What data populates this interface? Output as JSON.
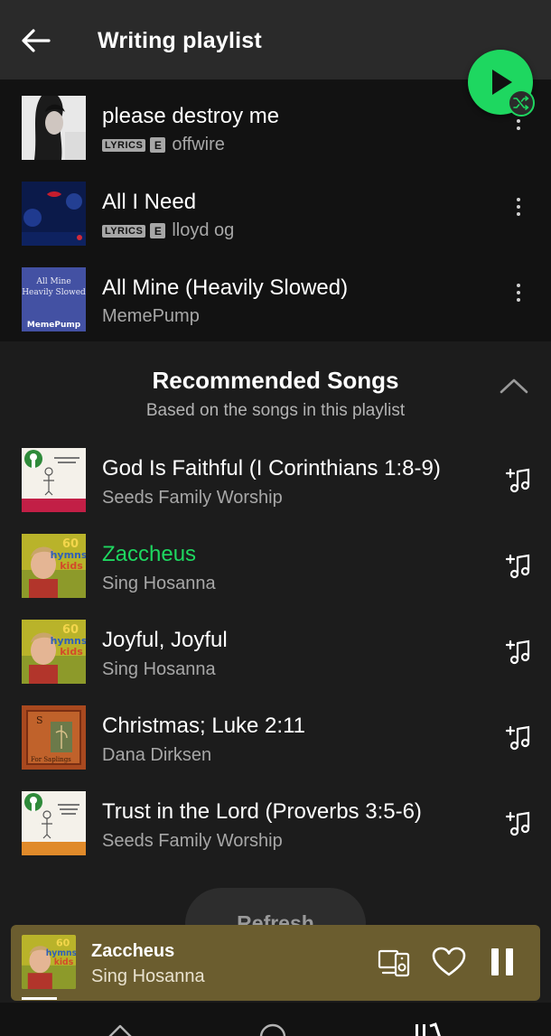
{
  "header": {
    "title": "Writing playlist"
  },
  "playlist_tracks": [
    {
      "title": "please destroy me",
      "artist": "offwire",
      "lyrics_badge": "LYRICS",
      "explicit_badge": "E"
    },
    {
      "title": "All I Need",
      "artist": "lloyd og",
      "lyrics_badge": "LYRICS",
      "explicit_badge": "E"
    },
    {
      "title": "All Mine (Heavily Slowed)",
      "artist": "MemePump",
      "art_text": "All Mine\nHeavily Slowed",
      "art_label": "MemePump"
    }
  ],
  "recommended": {
    "title": "Recommended Songs",
    "subtitle": "Based on the songs in this playlist",
    "tracks": [
      {
        "title": "God Is Faithful (I Corinthians 1:8-9)",
        "artist": "Seeds Family Worship",
        "playing": false
      },
      {
        "title": "Zaccheus",
        "artist": "Sing Hosanna",
        "playing": true
      },
      {
        "title": "Joyful, Joyful",
        "artist": "Sing Hosanna",
        "playing": false
      },
      {
        "title": "Christmas; Luke 2:11",
        "artist": "Dana Dirksen",
        "playing": false
      },
      {
        "title": "Trust in the Lord (Proverbs 3:5-6)",
        "artist": "Seeds Family Worship",
        "playing": false
      }
    ],
    "refresh_label": "Refresh"
  },
  "now_playing": {
    "title": "Zaccheus",
    "artist": "Sing Hosanna",
    "progress": 0.07
  },
  "colors": {
    "accent": "#1ed760",
    "background": "#121212",
    "section_bg": "#1c1c1c",
    "now_bar": "#6b5d2f",
    "subtext": "#a7a7a7"
  },
  "icons": [
    "back-arrow-icon",
    "play-icon",
    "shuffle-icon",
    "more-vert-icon",
    "chevron-up-icon",
    "add-to-playlist-icon",
    "devices-icon",
    "heart-icon",
    "pause-icon",
    "home-icon",
    "search-icon",
    "library-icon"
  ]
}
